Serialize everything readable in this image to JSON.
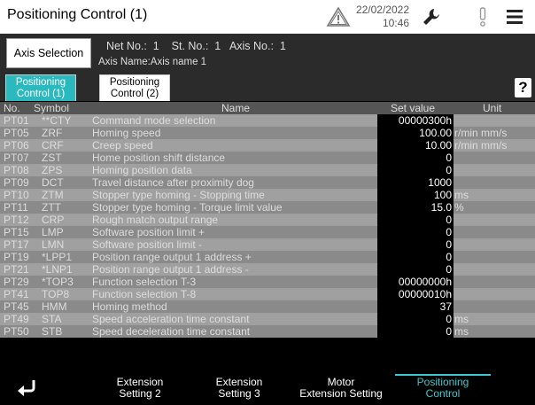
{
  "header": {
    "title": "Positioning Control (1)",
    "date": "22/02/2022",
    "time": "10:46"
  },
  "info": {
    "axis_button": "Axis Selection",
    "net_line": "Net No.:  1    St. No.:  1   Axis No.:  1",
    "axis_name_line": "Axis Name:Axis name 1"
  },
  "tabs": [
    {
      "line1": "Positioning",
      "line2": "Control (1)"
    },
    {
      "line1": "Positioning",
      "line2": "Control (2)"
    }
  ],
  "help_label": "?",
  "table": {
    "headers": {
      "no": "No.",
      "symbol": "Symbol",
      "name": "Name",
      "set_value": "Set value",
      "unit": "Unit"
    },
    "rows": [
      {
        "no": "PT01",
        "symbol": "**CTY",
        "name": "Command mode selection",
        "value": "00000300h",
        "unit": ""
      },
      {
        "no": "PT05",
        "symbol": "ZRF",
        "name": "Homing speed",
        "value": "100.00",
        "unit": "r/min mm/s"
      },
      {
        "no": "PT06",
        "symbol": "CRF",
        "name": "Creep speed",
        "value": "10.00",
        "unit": "r/min mm/s"
      },
      {
        "no": "PT07",
        "symbol": "ZST",
        "name": "Home position shift distance",
        "value": "0",
        "unit": ""
      },
      {
        "no": "PT08",
        "symbol": "ZPS",
        "name": "Homing position data",
        "value": "0",
        "unit": ""
      },
      {
        "no": "PT09",
        "symbol": "DCT",
        "name": "Travel distance after proximity dog",
        "value": "1000",
        "unit": ""
      },
      {
        "no": "PT10",
        "symbol": "ZTM",
        "name": "Stopper type homing - Stopping time",
        "value": "100",
        "unit": "ms"
      },
      {
        "no": "PT11",
        "symbol": "ZTT",
        "name": "Stopper type homing - Torque limit value",
        "value": "15.0",
        "unit": "%"
      },
      {
        "no": "PT12",
        "symbol": "CRP",
        "name": "Rough match output range",
        "value": "0",
        "unit": ""
      },
      {
        "no": "PT15",
        "symbol": "LMP",
        "name": "Software position limit +",
        "value": "0",
        "unit": ""
      },
      {
        "no": "PT17",
        "symbol": "LMN",
        "name": "Software position limit -",
        "value": "0",
        "unit": ""
      },
      {
        "no": "PT19",
        "symbol": "*LPP1",
        "name": "Position range output 1 address +",
        "value": "0",
        "unit": ""
      },
      {
        "no": "PT21",
        "symbol": "*LNP1",
        "name": "Position range output 1 address -",
        "value": "0",
        "unit": ""
      },
      {
        "no": "PT29",
        "symbol": "*TOP3",
        "name": "Function selection T-3",
        "value": "00000000h",
        "unit": ""
      },
      {
        "no": "PT41",
        "symbol": "TOP8",
        "name": "Function selection T-8",
        "value": "00000010h",
        "unit": ""
      },
      {
        "no": "PT45",
        "symbol": "HMM",
        "name": "Homing method",
        "value": "37",
        "unit": ""
      },
      {
        "no": "PT49",
        "symbol": "STA",
        "name": "Speed acceleration time constant",
        "value": "0",
        "unit": "ms"
      },
      {
        "no": "PT50",
        "symbol": "STB",
        "name": "Speed deceleration time constant",
        "value": "0",
        "unit": "ms"
      }
    ]
  },
  "nav": {
    "items": [
      {
        "line1": "Extension",
        "line2": "Setting 2"
      },
      {
        "line1": "Extension",
        "line2": "Setting 3"
      },
      {
        "line1": "Motor",
        "line2": "Extension Setting"
      },
      {
        "line1": "Positioning",
        "line2": "Control"
      }
    ]
  },
  "colors": {
    "accent": "#2bb9c0",
    "active_nav": "#3ec7d0",
    "row_light": "#a0a0a0",
    "row_dark": "#8a8a8a"
  },
  "icons": [
    "warning-icon",
    "wrench-icon",
    "alarm-icon",
    "menu-icon",
    "back-icon"
  ]
}
